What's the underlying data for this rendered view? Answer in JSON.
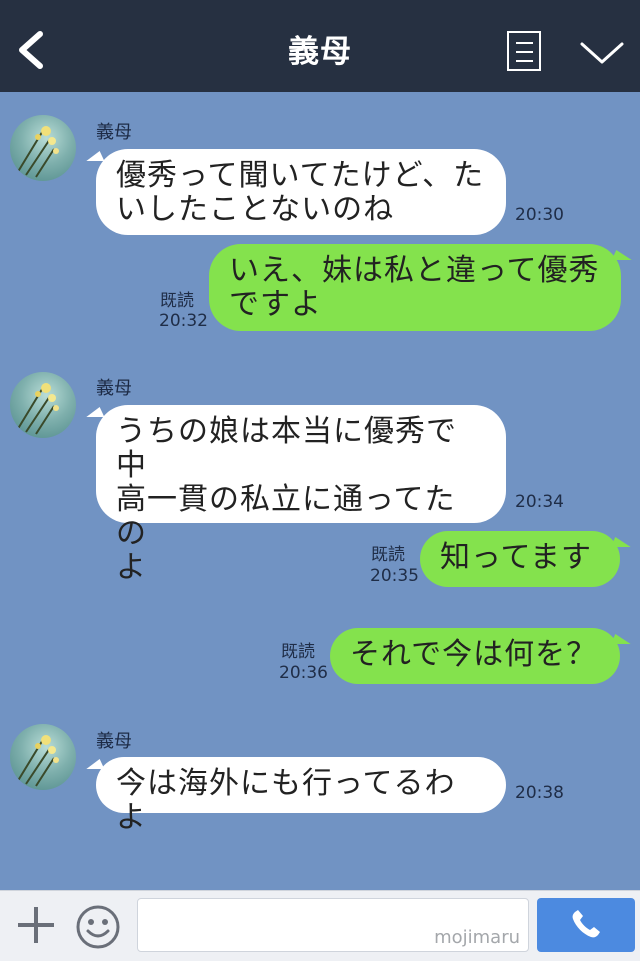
{
  "header": {
    "title": "義母"
  },
  "messages": [
    {
      "type": "in",
      "name": "義母",
      "text": "優秀って聞いてたけど、たいしたことないのね",
      "line1": "優秀って聞いてたけど、た",
      "line2": "いしたことないのね",
      "time": "20:30"
    },
    {
      "type": "out",
      "read": "既読",
      "line1": "いえ、妹は私と違って優秀",
      "line2": "ですよ",
      "time": "20:32"
    },
    {
      "type": "in",
      "name": "義母",
      "line1": "うちの娘は本当に優秀で中",
      "line2": "高一貫の私立に通ってたの",
      "line3": "よ",
      "time": "20:34"
    },
    {
      "type": "out",
      "read": "既読",
      "line1": "知ってます",
      "time": "20:35"
    },
    {
      "type": "out",
      "read": "既読",
      "line1": "それで今は何を？",
      "time": "20:36"
    },
    {
      "type": "in",
      "name": "義母",
      "line1": "今は海外にも行ってるわよ",
      "time": "20:38"
    }
  ],
  "footer": {
    "watermark": "mojimaru"
  },
  "colors": {
    "background": "#7193c3",
    "header": "#263041",
    "outgoing": "#84e24d",
    "incoming": "#ffffff",
    "send": "#4c8ae0"
  },
  "icons": [
    "back-arrow-icon",
    "notes-icon",
    "chevron-down-icon",
    "plus-icon",
    "smiley-icon",
    "phone-icon"
  ]
}
